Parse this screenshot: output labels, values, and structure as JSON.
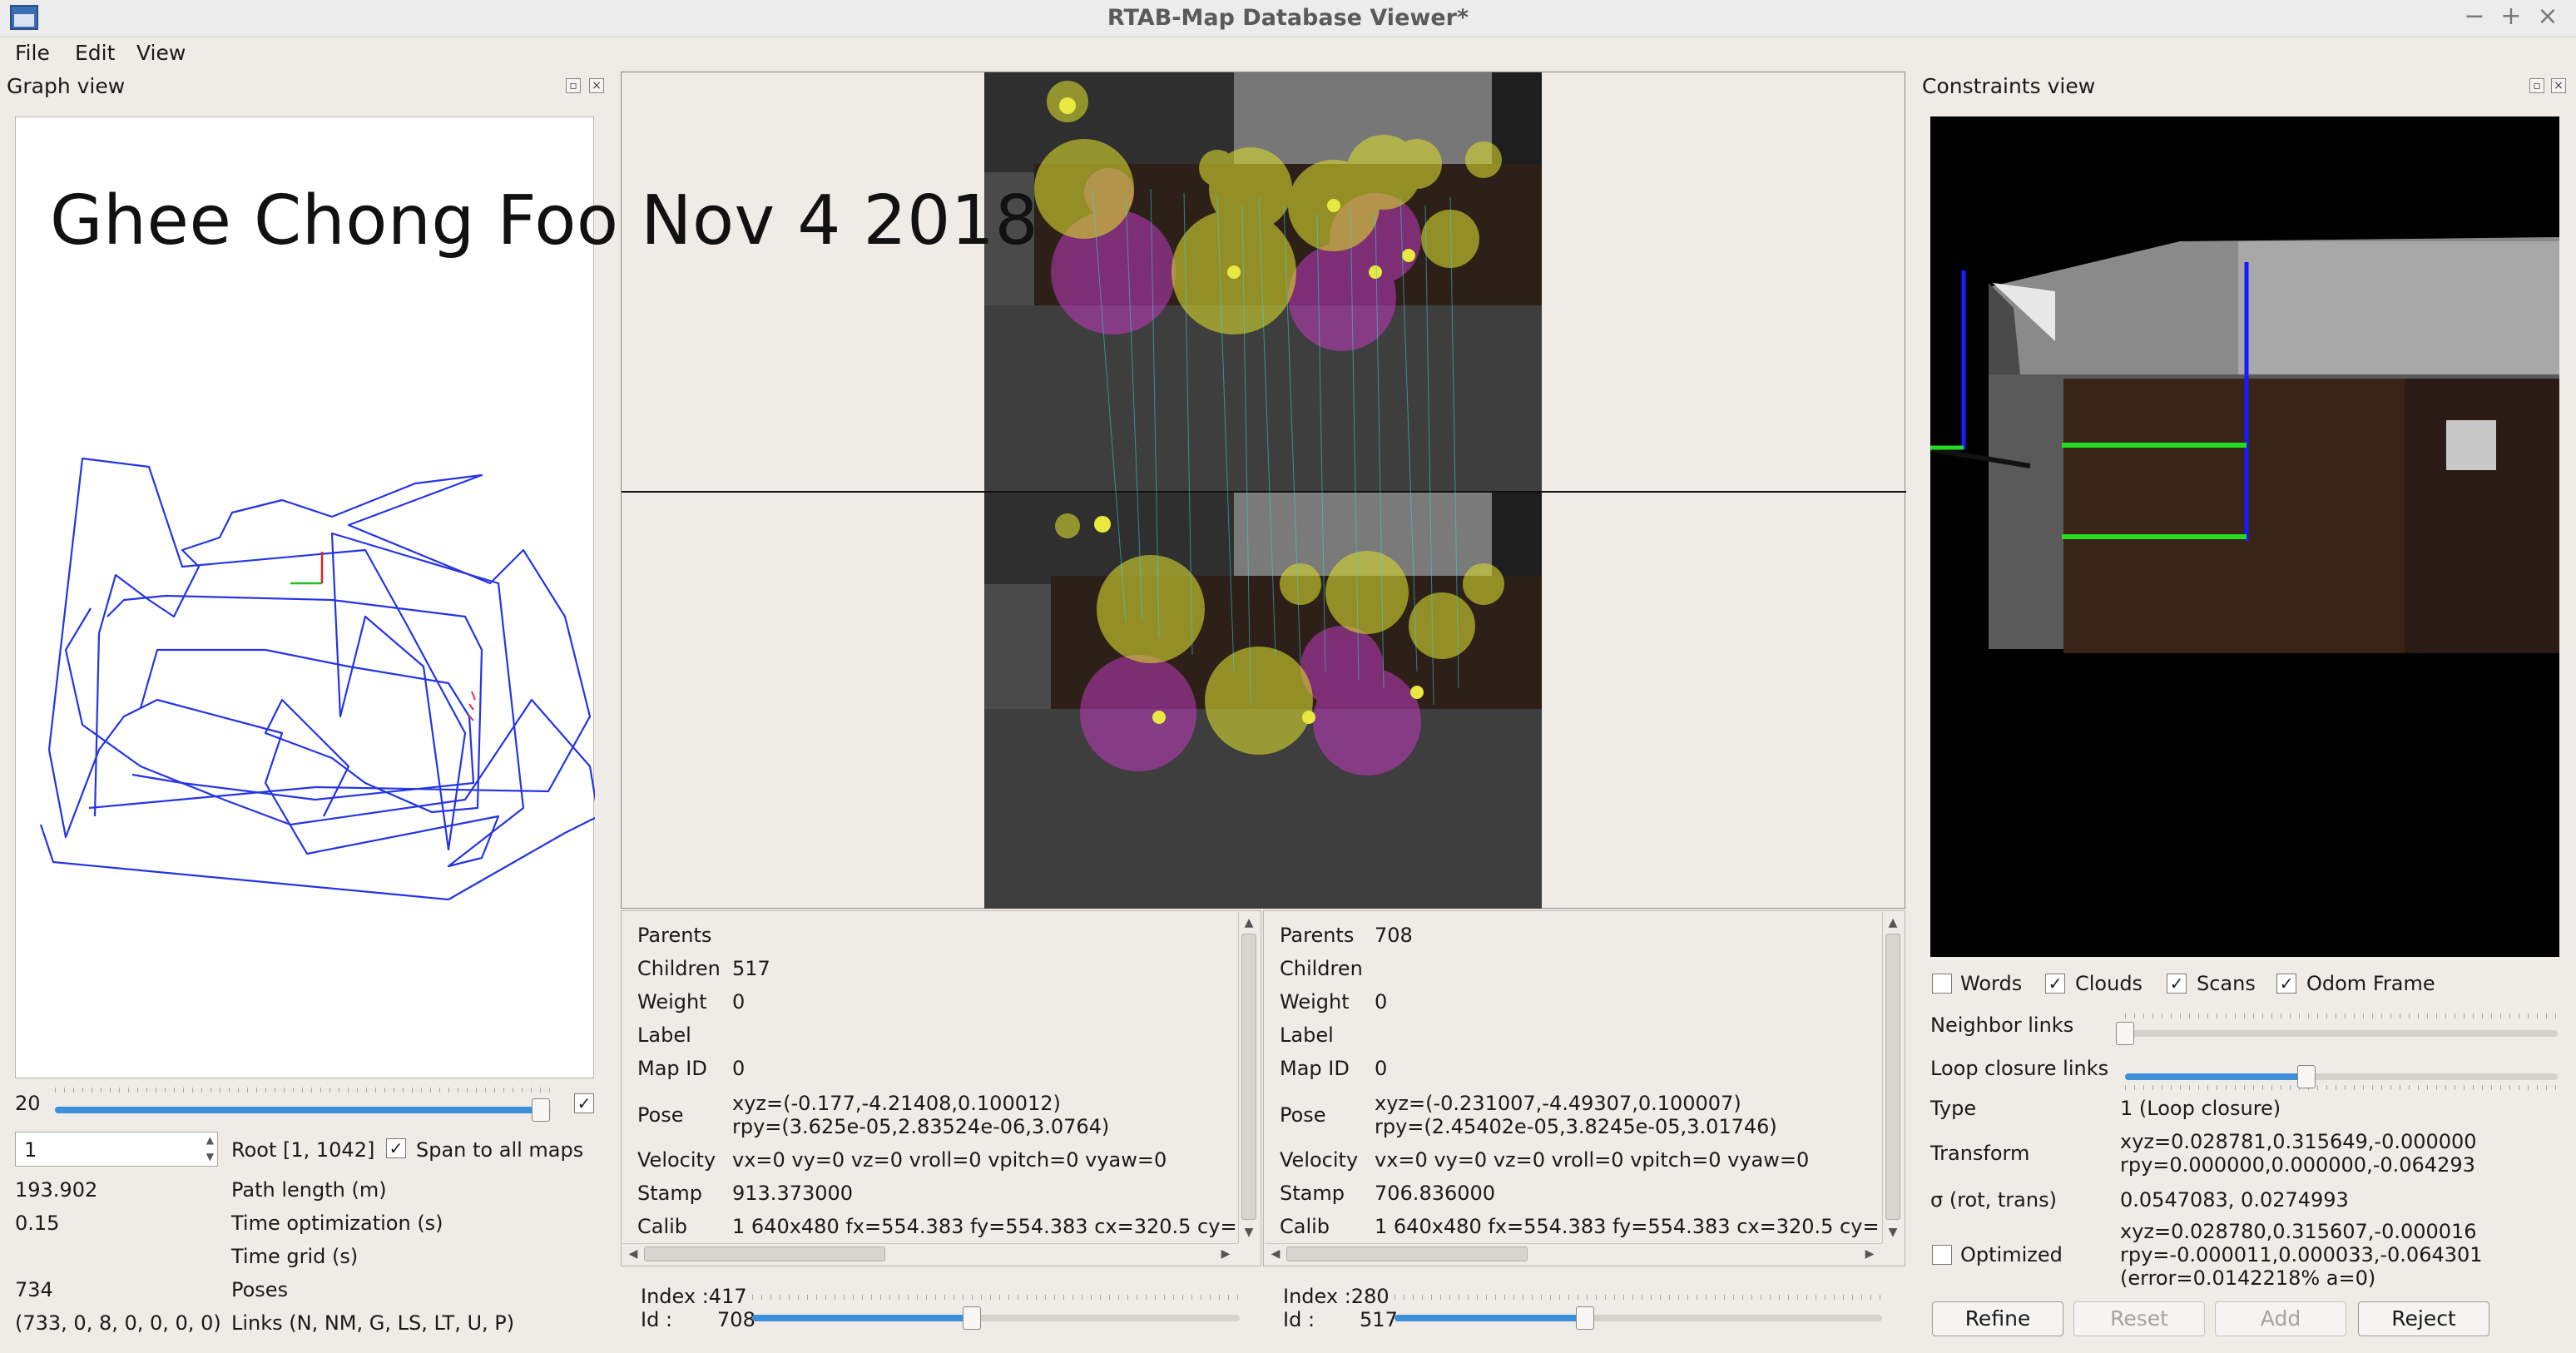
{
  "window": {
    "title": "RTAB-Map Database Viewer*",
    "minimize": "−",
    "maximize": "+",
    "close": "×"
  },
  "menu": [
    "File",
    "Edit",
    "View"
  ],
  "overlay_text": "Ghee Chong Foo Nov 4 2018",
  "graph_view": {
    "title": "Graph view",
    "slider_value": "20",
    "slider_fraction": 0.98,
    "slider_checked": "✓",
    "spin_value": "1",
    "root_label": "Root [1, 1042]",
    "span_label": "Span to all maps",
    "span_checked": "✓",
    "stats": [
      {
        "value": "193.902",
        "label": "Path length (m)"
      },
      {
        "value": "0.15",
        "label": "Time optimization (s)"
      },
      {
        "value": "",
        "label": "Time grid (s)"
      },
      {
        "value": "734",
        "label": "Poses"
      },
      {
        "value": "(733, 0, 8, 0, 0, 0, 0)",
        "label": "Links (N, NM, G, LS, LT, U, P)"
      }
    ]
  },
  "left_info": {
    "rows": [
      {
        "label": "Parents",
        "value": ""
      },
      {
        "label": "Children",
        "value": "517"
      },
      {
        "label": "Weight",
        "value": "0"
      },
      {
        "label": "Label",
        "value": ""
      },
      {
        "label": "Map ID",
        "value": "0"
      }
    ],
    "pose_label": "Pose",
    "pose_xyz": "xyz=(-0.177,-4.21408,0.100012)",
    "pose_rpy": "rpy=(3.625e-05,2.83524e-06,3.0764)",
    "velocity_label": "Velocity",
    "velocity_value": "vx=0 vy=0 vz=0 vroll=0 vpitch=0 vyaw=0",
    "stamp_label": "Stamp",
    "stamp_value": "913.373000",
    "calib_label": "Calib",
    "calib_value": "1 640x480 fx=554.383 fy=554.383 cx=320.5 cy=",
    "index_label": "Index :",
    "index_value": "417",
    "id_label": "Id :",
    "id_value": "708",
    "slider_fraction": 0.45
  },
  "right_info": {
    "rows": [
      {
        "label": "Parents",
        "value": "708"
      },
      {
        "label": "Children",
        "value": ""
      },
      {
        "label": "Weight",
        "value": "0"
      },
      {
        "label": "Label",
        "value": ""
      },
      {
        "label": "Map ID",
        "value": "0"
      }
    ],
    "pose_label": "Pose",
    "pose_xyz": "xyz=(-0.231007,-4.49307,0.100007)",
    "pose_rpy": "rpy=(2.45402e-05,3.8245e-05,3.01746)",
    "velocity_label": "Velocity",
    "velocity_value": "vx=0 vy=0 vz=0 vroll=0 vpitch=0 vyaw=0",
    "stamp_label": "Stamp",
    "stamp_value": "706.836000",
    "calib_label": "Calib",
    "calib_value": "1 640x480 fx=554.383 fy=554.383 cx=320.5 cy=",
    "index_label": "Index :",
    "index_value": "280",
    "id_label": "Id :",
    "id_value": "517",
    "slider_fraction": 0.39
  },
  "constraints_view": {
    "title": "Constraints view",
    "checkboxes": [
      {
        "label": "Words",
        "checked": ""
      },
      {
        "label": "Clouds",
        "checked": "✓"
      },
      {
        "label": "Scans",
        "checked": "✓"
      },
      {
        "label": "Odom Frame",
        "checked": "✓"
      }
    ],
    "neighbor_links_label": "Neighbor links",
    "neighbor_links_fraction": 0.0,
    "loop_closure_links_label": "Loop closure links",
    "loop_closure_links_fraction": 0.42,
    "type_label": "Type",
    "type_value": "1 (Loop closure)",
    "transform_label": "Transform",
    "transform_xyz": "xyz=0.028781,0.315649,-0.000000",
    "transform_rpy": "rpy=0.000000,0.000000,-0.064293",
    "sigma_label": "σ (rot, trans)",
    "sigma_value": "0.0547083, 0.0274993",
    "optimized_label": "Optimized",
    "optimized_checked": "",
    "optimized_xyz": "xyz=0.028780,0.315607,-0.000016",
    "optimized_rpy": "rpy=-0.000011,0.000033,-0.064301",
    "optimized_error": "(error=0.0142218% a=0)",
    "buttons": {
      "refine": "Refine",
      "reset": "Reset",
      "add": "Add",
      "reject": "Reject"
    }
  }
}
